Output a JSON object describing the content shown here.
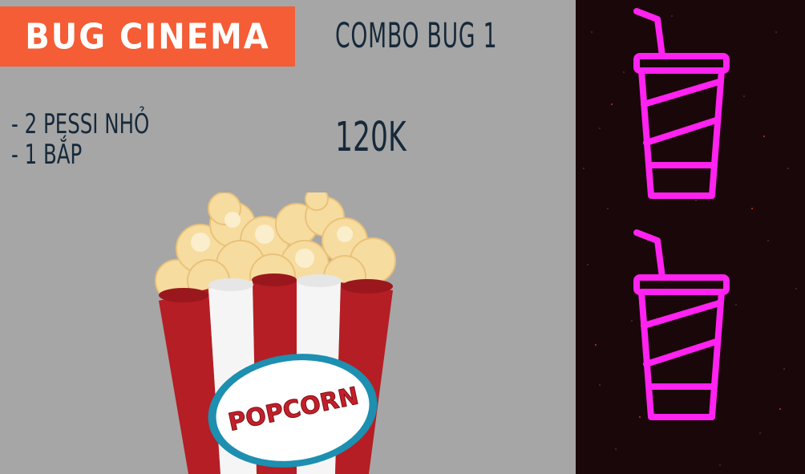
{
  "brand": {
    "name": "BUG CINEMA",
    "color": "#f45d35"
  },
  "combo": {
    "title": "COMBO BUG 1",
    "items": [
      "- 2 PESSI NHỎ",
      "- 1 BẮP"
    ],
    "price": "120K"
  },
  "popcorn": {
    "label": "POPCORN",
    "icon": "popcorn-bucket-icon"
  },
  "drinks": {
    "icon": "drink-cup-icon",
    "color": "#ff22f0",
    "count": 2
  },
  "colors": {
    "background": "#a6a6a6",
    "text": "#16293a",
    "dark_panel": "#1a0709",
    "bucket_red": "#b51e24"
  }
}
